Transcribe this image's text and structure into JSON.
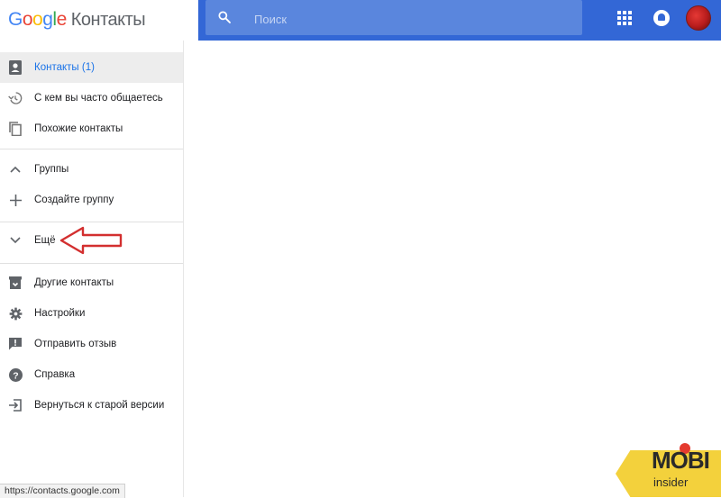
{
  "header": {
    "logo_brand": "Google",
    "app_title": "Контакты",
    "search_placeholder": "Поиск"
  },
  "sidebar": {
    "items": [
      {
        "label": "Контакты (1)",
        "icon": "contact-card-icon",
        "active": true
      },
      {
        "label": "С кем вы часто общаетесь",
        "icon": "history-icon"
      },
      {
        "label": "Похожие контакты",
        "icon": "copy-icon"
      },
      {
        "label": "Группы",
        "icon": "chevron-up-icon"
      },
      {
        "label": "Создайте группу",
        "icon": "plus-icon"
      },
      {
        "label": "Ещё",
        "icon": "chevron-down-icon"
      },
      {
        "label": "Другие контакты",
        "icon": "archive-icon"
      },
      {
        "label": "Настройки",
        "icon": "gear-icon"
      },
      {
        "label": "Отправить отзыв",
        "icon": "feedback-icon"
      },
      {
        "label": "Справка",
        "icon": "help-icon"
      },
      {
        "label": "Вернуться к старой версии",
        "icon": "exit-icon"
      }
    ]
  },
  "status_url": "https://contacts.google.com",
  "watermark": {
    "line1": "MOBI",
    "line2": "insider"
  },
  "colors": {
    "topbar": "#3367d6",
    "search": "#5a86dd",
    "active_text": "#1a73e8",
    "arrow": "#d32f2f",
    "watermark": "#f3d13c"
  }
}
